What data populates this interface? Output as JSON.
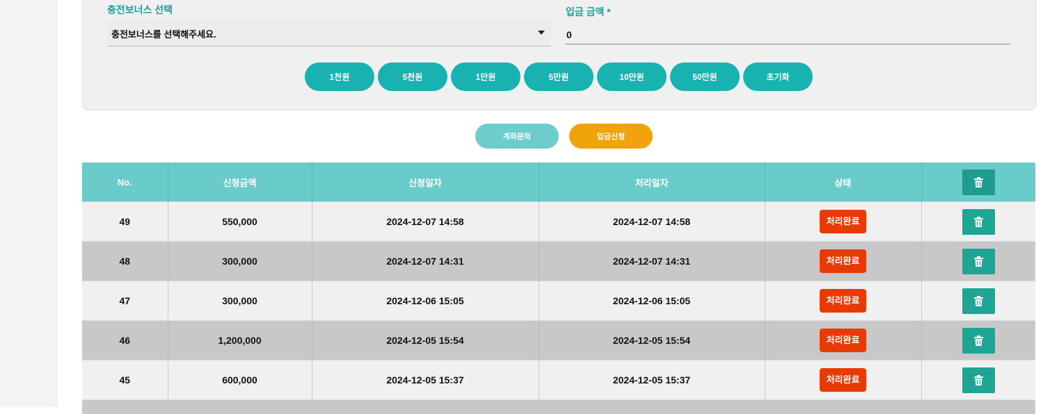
{
  "form": {
    "bonus_label": "충전보너스 선택",
    "bonus_select_value": "충전보너스를 선택해주세요.",
    "amount_label": "입금 금액 *",
    "amount_value": "0"
  },
  "quick_amounts": [
    "1천원",
    "5천원",
    "1만원",
    "5만원",
    "10만원",
    "50만원",
    "초기화"
  ],
  "actions": {
    "account_inquiry": "계좌문의",
    "deposit_request": "입금신청"
  },
  "table": {
    "headers": [
      "No.",
      "신청금액",
      "신청일자",
      "처리일자",
      "상태"
    ],
    "rows": [
      {
        "no": "49",
        "amount": "550,000",
        "requested": "2024-12-07 14:58",
        "processed": "2024-12-07 14:58",
        "status": "처리완료"
      },
      {
        "no": "48",
        "amount": "300,000",
        "requested": "2024-12-07 14:31",
        "processed": "2024-12-07 14:31",
        "status": "처리완료"
      },
      {
        "no": "47",
        "amount": "300,000",
        "requested": "2024-12-06 15:05",
        "processed": "2024-12-06 15:05",
        "status": "처리완료"
      },
      {
        "no": "46",
        "amount": "1,200,000",
        "requested": "2024-12-05 15:54",
        "processed": "2024-12-05 15:54",
        "status": "처리완료"
      },
      {
        "no": "45",
        "amount": "600,000",
        "requested": "2024-12-05 15:37",
        "processed": "2024-12-05 15:37",
        "status": "처리완료"
      }
    ]
  },
  "icons": {
    "delete": "trash-icon",
    "dropdown": "chevron-down-icon"
  },
  "colors": {
    "accent": "#18b2b0",
    "header": "#69cbca",
    "deposit_button": "#f0a30a",
    "status_done": "#e83a04",
    "trash_button": "#1fa593"
  }
}
